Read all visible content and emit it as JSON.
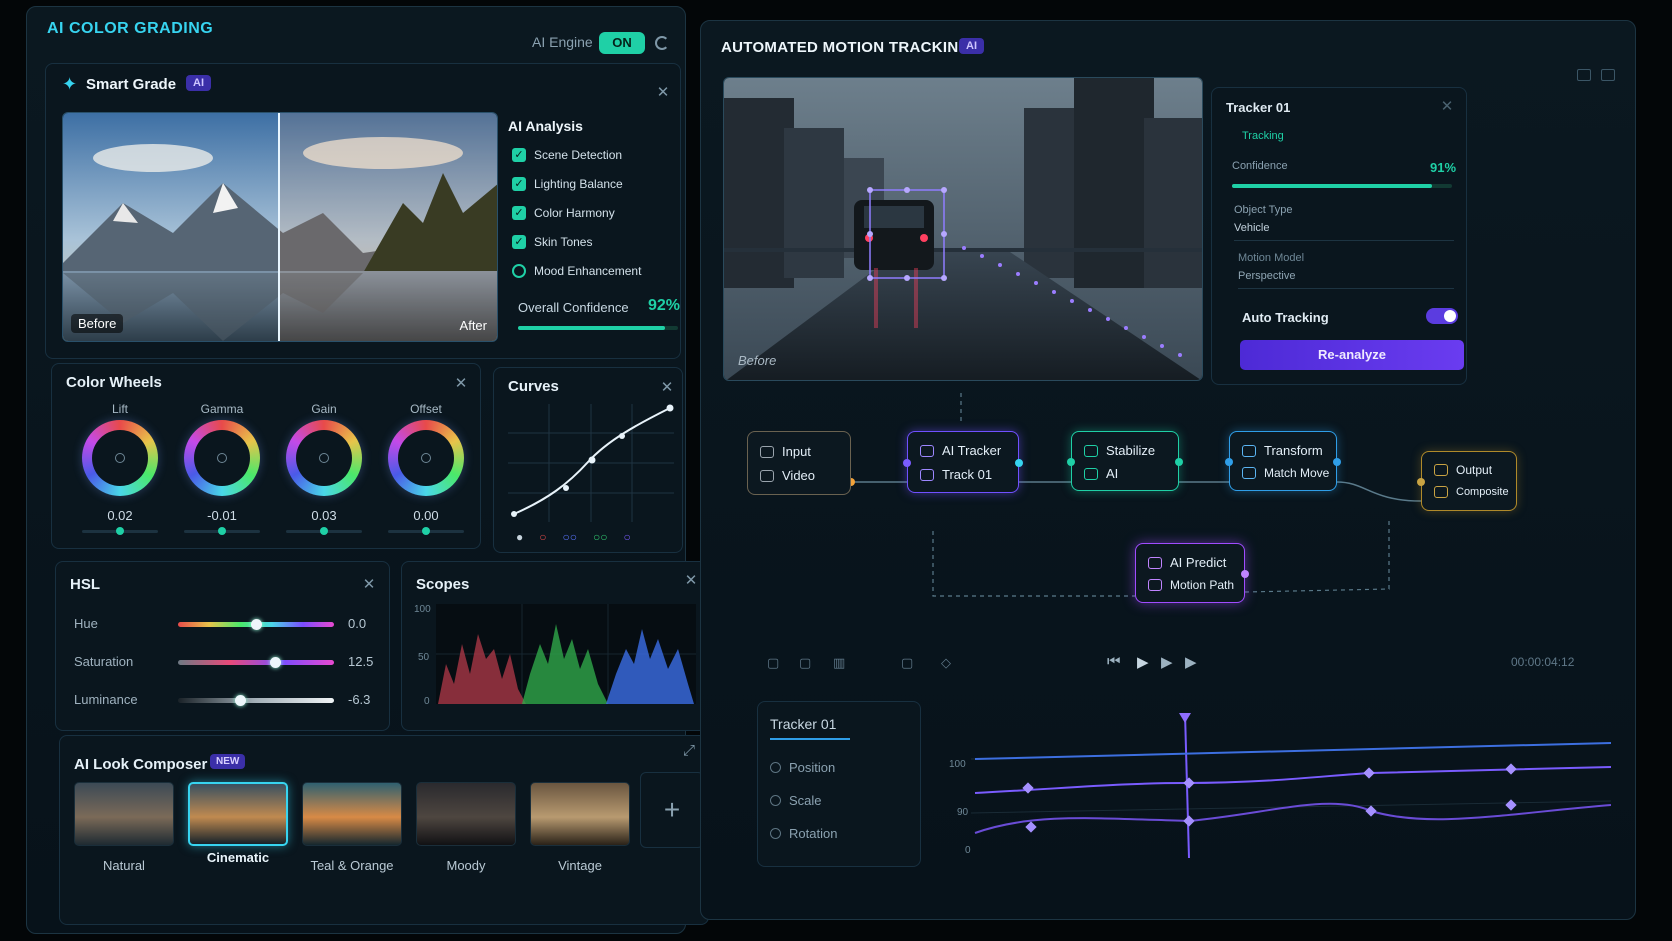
{
  "colors": {
    "teal": "#1fd0a6",
    "purple": "#7a4cff",
    "accent_title": "#37d4f0"
  },
  "left_panel": {
    "title": "AI COLOR GRADING",
    "engine_label": "AI Engine",
    "engine_state": "ON"
  },
  "smart_grade": {
    "title": "Smart Grade",
    "badge": "AI",
    "before_label": "Before",
    "after_label": "After",
    "analysis_title": "AI Analysis",
    "analysis_items": [
      {
        "label": "Scene Detection",
        "checked": true
      },
      {
        "label": "Lighting Balance",
        "checked": true
      },
      {
        "label": "Color Harmony",
        "checked": true
      },
      {
        "label": "Skin Tones",
        "checked": true
      },
      {
        "label": "Mood Enhancement",
        "checked": false
      }
    ],
    "confidence_label": "Overall Confidence",
    "confidence_value": "92%",
    "confidence_fraction": 0.92
  },
  "color_wheels": {
    "title": "Color Wheels",
    "wheels": [
      {
        "label": "Lift",
        "value": "0.02"
      },
      {
        "label": "Gamma",
        "value": "-0.01"
      },
      {
        "label": "Gain",
        "value": "0.03"
      },
      {
        "label": "Offset",
        "value": "0.00"
      }
    ]
  },
  "curves": {
    "title": "Curves"
  },
  "hsl": {
    "title": "HSL",
    "rows": [
      {
        "label": "Hue",
        "value": "0.0",
        "level": 0.5
      },
      {
        "label": "Saturation",
        "value": "12.5",
        "level": 0.62
      },
      {
        "label": "Luminance",
        "value": "-6.3",
        "level": 0.4
      }
    ]
  },
  "scopes": {
    "title": "Scopes",
    "axis": [
      "100",
      "50",
      "0"
    ]
  },
  "look_composer": {
    "title": "AI Look Composer",
    "badge": "NEW",
    "looks": [
      "Natural",
      "Cinematic",
      "Teal & Orange",
      "Moody",
      "Vintage"
    ],
    "selected": "Cinematic",
    "add_icon": "plus-icon"
  },
  "right_panel": {
    "title": "AUTOMATED MOTION TRACKING",
    "badge": "AI",
    "video_label": "Before"
  },
  "tracker": {
    "title": "Tracker 01",
    "status": "Tracking",
    "confidence_label": "Confidence",
    "confidence_value": "91%",
    "confidence_fraction": 0.91,
    "object_type_label": "Object Type",
    "object_type_value": "Vehicle",
    "motion_model_label": "Motion Model",
    "motion_model_value": "Perspective",
    "auto_tracking_label": "Auto Tracking",
    "reanalyze_label": "Re-analyze"
  },
  "nodes": {
    "input": {
      "line1": "Input",
      "line2": "Video"
    },
    "tracker": {
      "line1": "AI Tracker",
      "line2": "Track 01"
    },
    "stabilize": {
      "line1": "Stabilize",
      "line2": "AI"
    },
    "transform": {
      "line1": "Transform",
      "line2": "Match Move"
    },
    "output": {
      "line1": "Output",
      "line2": "Composite"
    },
    "predict": {
      "line1": "AI Predict",
      "line2": "Motion Path"
    }
  },
  "timeline": {
    "timecode": "00:00:04:12",
    "track_name": "Tracker 01",
    "params": [
      "Position",
      "Scale",
      "Rotation"
    ],
    "y_axis": [
      "100",
      "90",
      "0"
    ]
  }
}
